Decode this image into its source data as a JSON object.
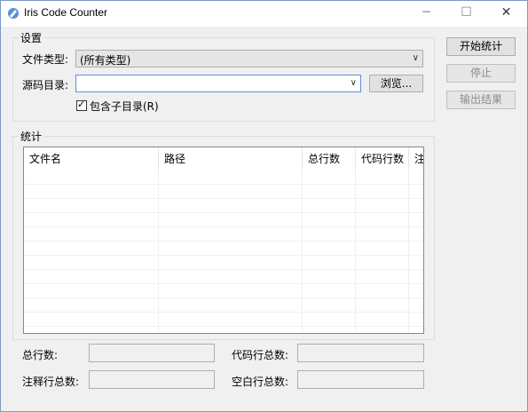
{
  "window": {
    "title": "Iris Code Counter",
    "minimize": "─",
    "maximize": "☐",
    "close": "✕"
  },
  "settings": {
    "group_label": "设置",
    "file_type_label": "文件类型:",
    "file_type_value": "(所有类型)",
    "source_dir_label": "源码目录:",
    "source_dir_value": "",
    "browse_label": "浏览...",
    "include_subdirs_label": "包含子目录(R)",
    "include_subdirs_checked": true
  },
  "actions": {
    "start": "开始统计",
    "stop": "停止",
    "export": "输出结果"
  },
  "stats": {
    "group_label": "统计",
    "columns": [
      "文件名",
      "路径",
      "总行数",
      "代码行数",
      "注"
    ],
    "total_lines_label": "总行数:",
    "code_lines_label": "代码行总数:",
    "comment_lines_label": "注释行总数:",
    "blank_lines_label": "空白行总数:",
    "total_lines_value": "",
    "code_lines_value": "",
    "comment_lines_value": "",
    "blank_lines_value": ""
  }
}
